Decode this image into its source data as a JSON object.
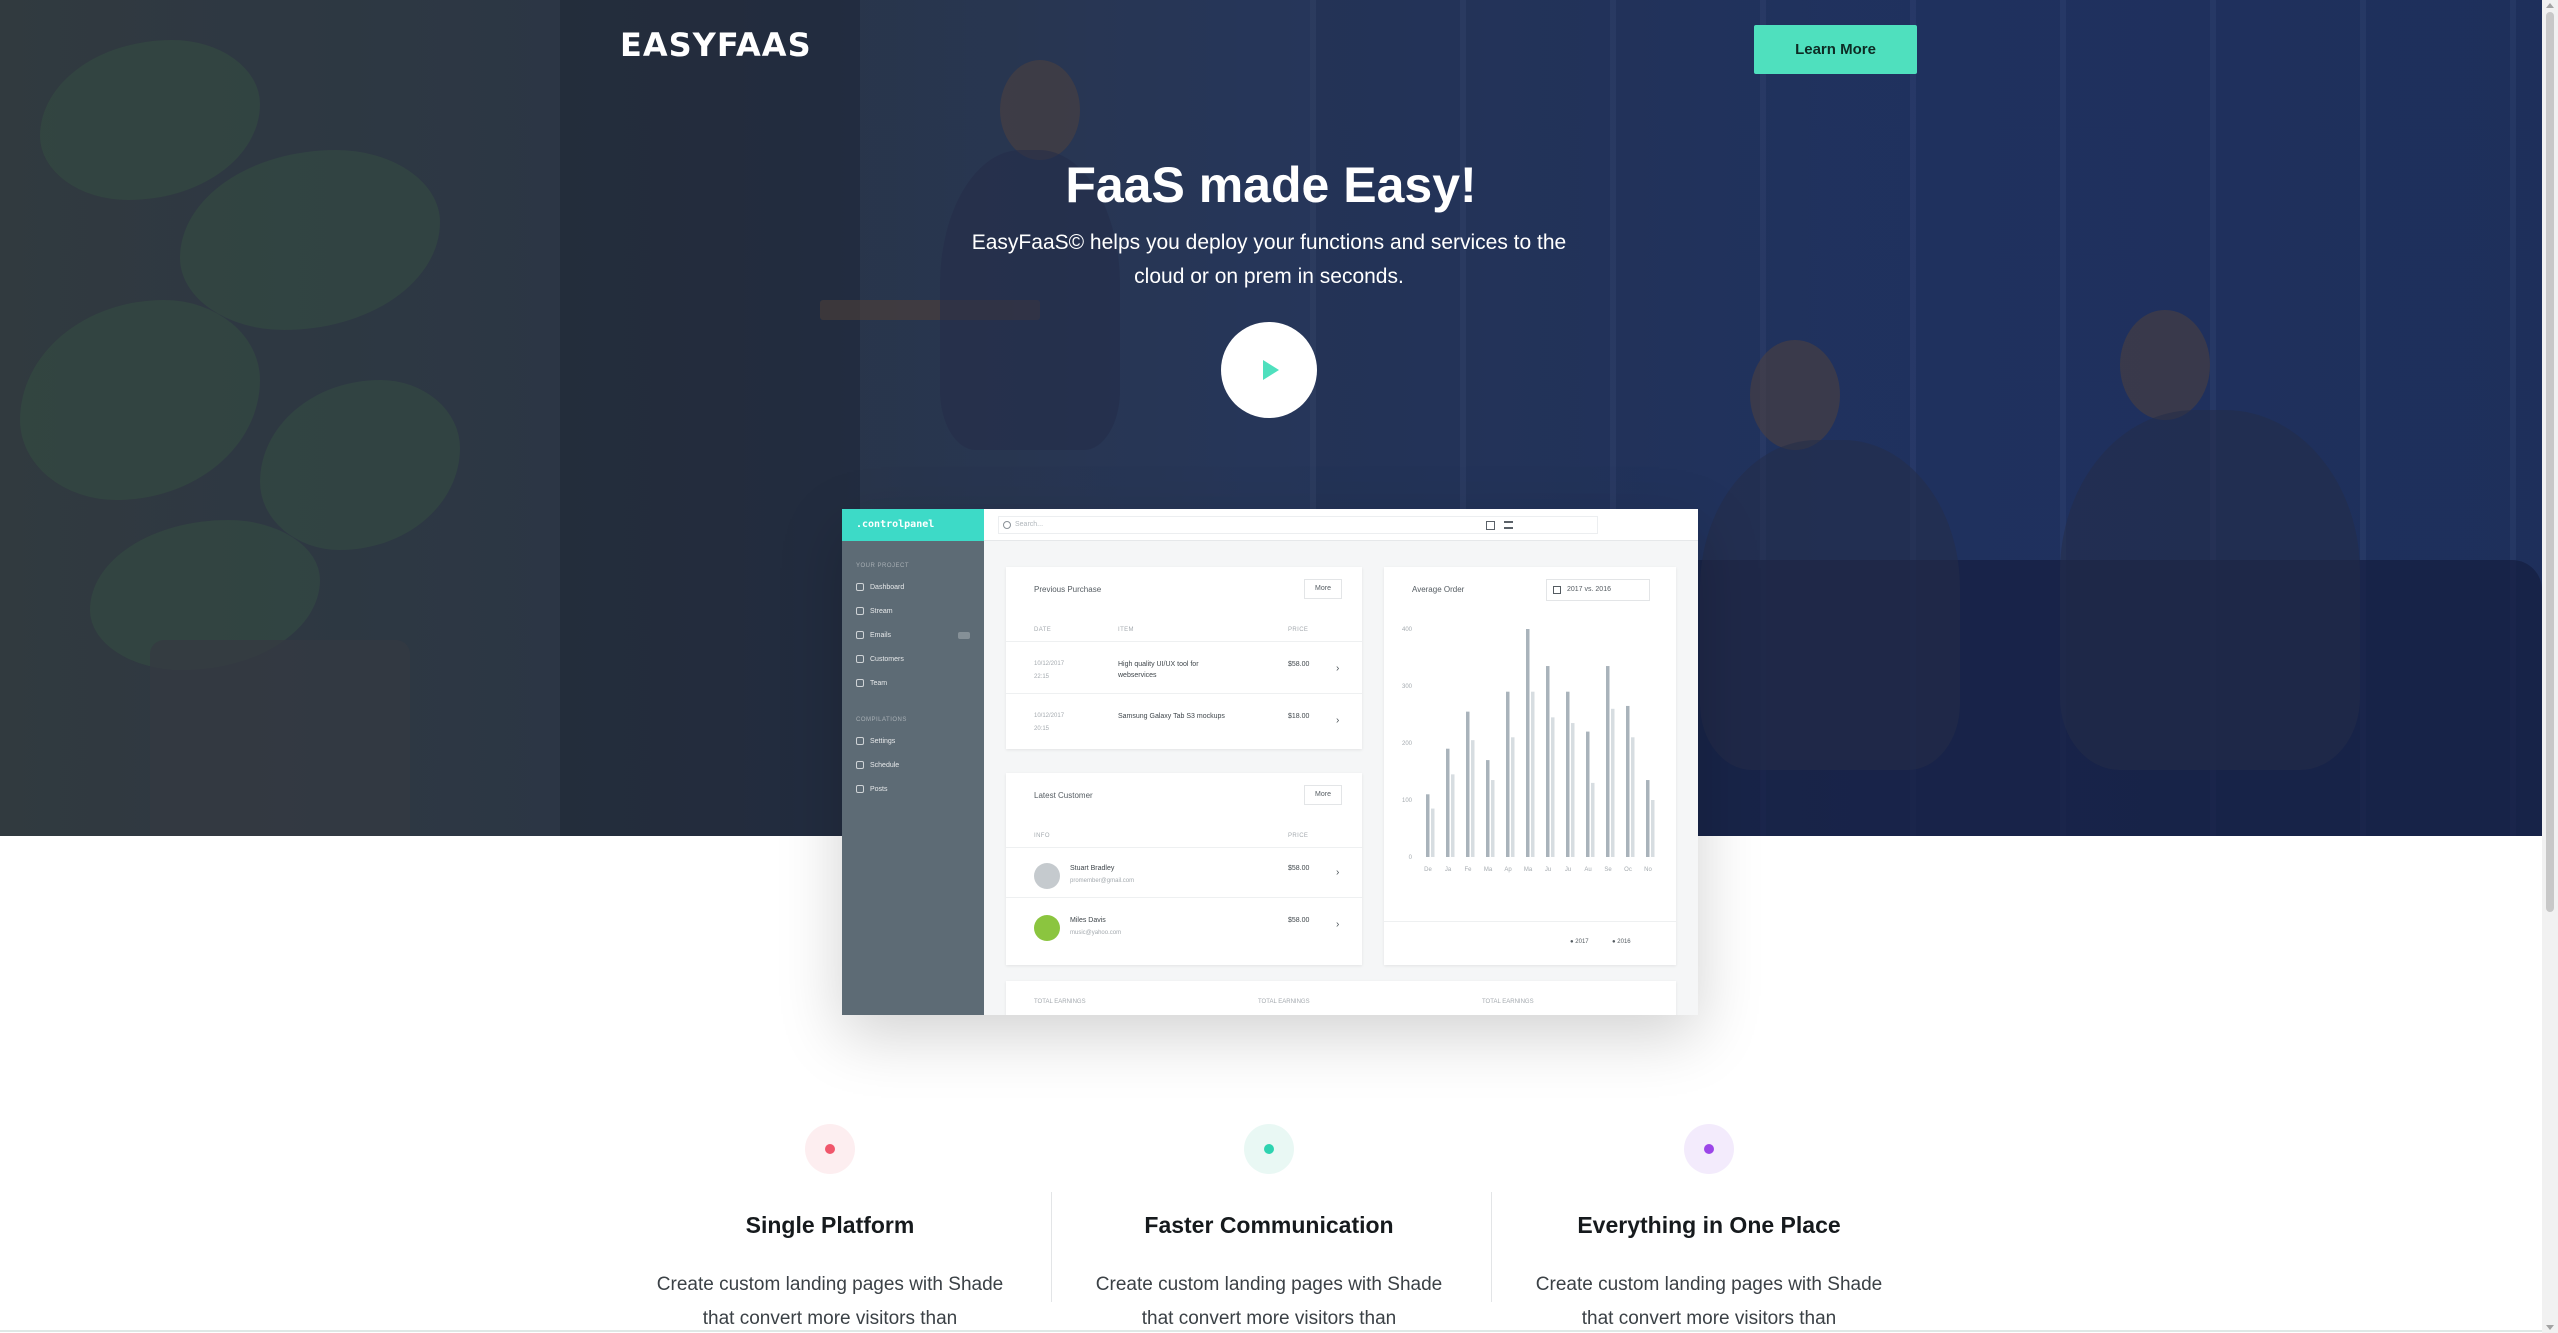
{
  "header": {
    "logo": "EASYFAAS",
    "learn_more": "Learn More"
  },
  "hero": {
    "title": "FaaS made Easy!",
    "subtitle": "EasyFaaS© helps you deploy your functions and services to the cloud or on prem in seconds."
  },
  "mockup": {
    "brand": ".controlpanel",
    "search_placeholder": "Search...",
    "section1": "YOUR PROJECT",
    "nav1": [
      "Dashboard",
      "Stream",
      "Emails",
      "Customers",
      "Team"
    ],
    "section2": "COMPILATIONS",
    "nav2": [
      "Settings",
      "Schedule",
      "Posts"
    ],
    "previous_purchase": {
      "title": "Previous Purchase",
      "more": "More",
      "headers": [
        "DATE",
        "ITEM",
        "PRICE"
      ],
      "rows": [
        {
          "date": "10/12/2017",
          "time": "22:15",
          "item": "High quality UI/UX tool for webservices",
          "price": "$58.00"
        },
        {
          "date": "10/12/2017",
          "time": "20:15",
          "item": "Samsung Galaxy Tab S3 mockups",
          "price": "$18.00"
        }
      ]
    },
    "latest_customer": {
      "title": "Latest Customer",
      "more": "More",
      "headers": [
        "INFO",
        "PRICE"
      ],
      "rows": [
        {
          "name": "Stuart Bradley",
          "email": "promember@gmail.com",
          "price": "$58.00"
        },
        {
          "name": "Miles Davis",
          "email": "music@yahoo.com",
          "price": "$58.00"
        }
      ]
    },
    "average_order": {
      "title": "Average Order",
      "range": "2017 vs. 2016",
      "yticks": [
        "400",
        "300",
        "200",
        "100",
        "0"
      ],
      "months": [
        "De",
        "Ja",
        "Fe",
        "Ma",
        "Ap",
        "Ma",
        "Ju",
        "Ju",
        "Au",
        "Se",
        "Oc",
        "No"
      ],
      "legend": [
        "2017",
        "2016"
      ]
    },
    "total_earnings": [
      "TOTAL EARNINGS",
      "TOTAL EARNINGS",
      "TOTAL EARNINGS"
    ]
  },
  "chart_data": {
    "type": "bar",
    "title": "Average Order",
    "categories": [
      "De",
      "Ja",
      "Fe",
      "Ma",
      "Ap",
      "Ma",
      "Ju",
      "Ju",
      "Au",
      "Se",
      "Oc",
      "No"
    ],
    "series": [
      {
        "name": "2017",
        "values": [
          110,
          190,
          255,
          170,
          290,
          400,
          335,
          290,
          220,
          335,
          265,
          135
        ]
      },
      {
        "name": "2016",
        "values": [
          85,
          145,
          205,
          135,
          210,
          290,
          245,
          235,
          130,
          260,
          210,
          100
        ]
      }
    ],
    "ylim": [
      0,
      400
    ],
    "colors": {
      "2017": "#a9b3bb",
      "2016": "#d7dde1"
    }
  },
  "features": [
    {
      "title": "Single Platform",
      "text": "Create custom landing pages with Shade that convert more visitors than",
      "color": "#f0566b",
      "bg": "#fdeef0"
    },
    {
      "title": "Faster Communication",
      "text": "Create custom landing pages with Shade that convert more visitors than",
      "color": "#2ed3b0",
      "bg": "#e9f8f4"
    },
    {
      "title": "Everything in One Place",
      "text": "Create custom landing pages with Shade that convert more visitors than",
      "color": "#9b45e8",
      "bg": "#f3ebfc"
    }
  ],
  "colors": {
    "accent": "#4fe0be",
    "brand_teal": "#3ddac7"
  }
}
